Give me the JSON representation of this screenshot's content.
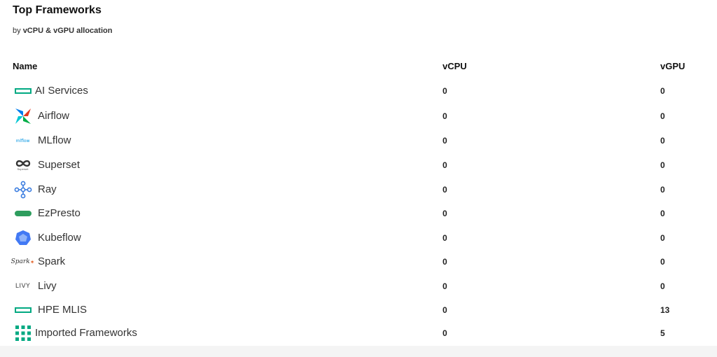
{
  "panel": {
    "title": "Top Frameworks",
    "subtitle_prefix": "by",
    "subtitle": "vCPU & vGPU allocation"
  },
  "table": {
    "columns": [
      "Name",
      "vCPU",
      "vGPU"
    ],
    "rows": [
      {
        "name": "AI Services",
        "icon": "hpe-bar-icon",
        "vcpu": "0",
        "vgpu": "0"
      },
      {
        "name": "Airflow",
        "icon": "airflow-icon",
        "vcpu": "0",
        "vgpu": "0"
      },
      {
        "name": "MLflow",
        "icon": "mlflow-icon",
        "vcpu": "0",
        "vgpu": "0"
      },
      {
        "name": "Superset",
        "icon": "superset-icon",
        "vcpu": "0",
        "vgpu": "0"
      },
      {
        "name": "Ray",
        "icon": "ray-icon",
        "vcpu": "0",
        "vgpu": "0"
      },
      {
        "name": "EzPresto",
        "icon": "ezpresto-icon",
        "vcpu": "0",
        "vgpu": "0"
      },
      {
        "name": "Kubeflow",
        "icon": "kubeflow-icon",
        "vcpu": "0",
        "vgpu": "0"
      },
      {
        "name": "Spark",
        "icon": "spark-icon",
        "vcpu": "0",
        "vgpu": "0"
      },
      {
        "name": "Livy",
        "icon": "livy-icon",
        "vcpu": "0",
        "vgpu": "0"
      },
      {
        "name": "HPE MLIS",
        "icon": "hpe-bar-icon",
        "vcpu": "0",
        "vgpu": "13"
      },
      {
        "name": "Imported Frameworks",
        "icon": "grid-dots-icon",
        "vcpu": "0",
        "vgpu": "5"
      }
    ]
  },
  "icon_text": {
    "mlflow": "mlflow",
    "spark": "Spark",
    "livy": "LIVY",
    "superset": "Superset"
  },
  "colors": {
    "hpe_green": "#01a982",
    "ezpresto_green": "#2e9d5e",
    "airflow_blue": "#017cee",
    "airflow_red": "#e43921",
    "airflow_green": "#00ad46",
    "ray_blue": "#3b7de0",
    "kubeflow_blue": "#4279f4",
    "spark_orange": "#e25a1c"
  }
}
